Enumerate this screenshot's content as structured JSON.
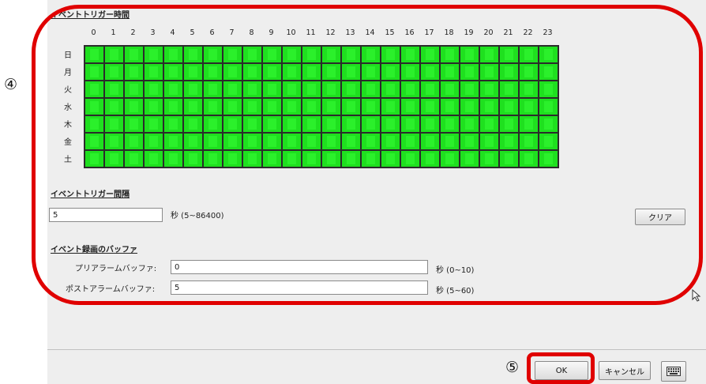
{
  "trigger_time": {
    "title": "イベントトリガー時間",
    "hours": [
      "0",
      "1",
      "2",
      "3",
      "4",
      "5",
      "6",
      "7",
      "8",
      "9",
      "10",
      "11",
      "12",
      "13",
      "14",
      "15",
      "16",
      "17",
      "18",
      "19",
      "20",
      "21",
      "22",
      "23"
    ],
    "days": [
      "日",
      "月",
      "火",
      "水",
      "木",
      "金",
      "土"
    ],
    "cell_color": "#1fe01f"
  },
  "trigger_interval": {
    "title": "イベントトリガー間隔",
    "value": "5",
    "unit": "秒 (5~86400)",
    "clear_label": "クリア"
  },
  "buffer": {
    "title": "イベント録画のバッファ",
    "pre_label": "プリアラームバッファ:",
    "pre_value": "0",
    "pre_unit": "秒 (0~10)",
    "post_label": "ポストアラームバッファ:",
    "post_value": "5",
    "post_unit": "秒 (5~60)"
  },
  "footer": {
    "ok_label": "OK",
    "cancel_label": "キャンセル",
    "keyboard_icon": "keyboard-icon"
  },
  "annotations": {
    "marker4": "④",
    "marker5": "⑤",
    "color": "#e00000"
  }
}
